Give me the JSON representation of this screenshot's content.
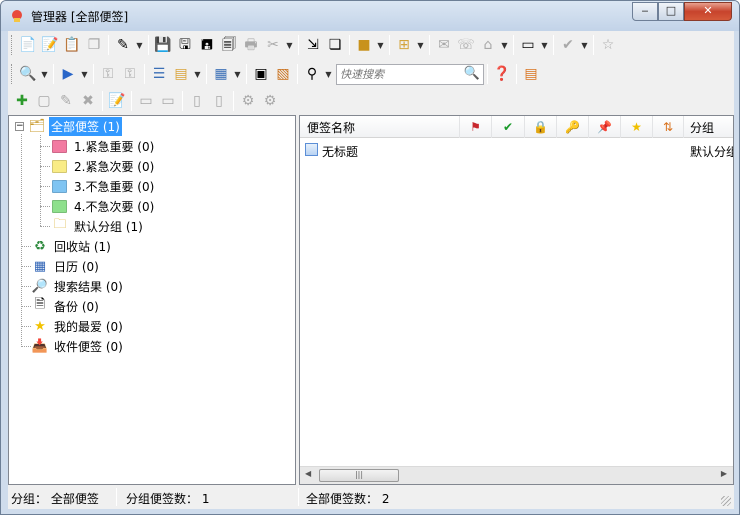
{
  "window": {
    "title": "管理器 [全部便签]",
    "minimize": "‒",
    "maximize": "□",
    "close": "✕"
  },
  "search": {
    "placeholder": "快速搜索"
  },
  "tree": {
    "root": {
      "label": "全部便签 (1)"
    },
    "groups": [
      {
        "label": "1.紧急重要 (0)",
        "color": "#f27aa1"
      },
      {
        "label": "2.紧急次要 (0)",
        "color": "#f9ec86"
      },
      {
        "label": "3.不急重要 (0)",
        "color": "#7fc4f2"
      },
      {
        "label": "4.不急次要 (0)",
        "color": "#8ee08c"
      },
      {
        "label": "默认分组 (1)",
        "color": "#f7d35f"
      }
    ],
    "others": [
      {
        "label": "回收站 (1)",
        "icon": "recycle-bin-icon"
      },
      {
        "label": "日历 (0)",
        "icon": "calendar-icon"
      },
      {
        "label": "搜索结果 (0)",
        "icon": "search-results-icon"
      },
      {
        "label": "备份 (0)",
        "icon": "backup-icon"
      },
      {
        "label": "我的最爱 (0)",
        "icon": "favorite-star-icon"
      },
      {
        "label": "收件便签 (0)",
        "icon": "inbox-icon"
      }
    ]
  },
  "list": {
    "columns": {
      "name": "便签名称",
      "group": "分组"
    },
    "rows": [
      {
        "name": "无标题",
        "group": "默认分组"
      }
    ]
  },
  "status": {
    "group": "分组： 全部便签",
    "group_count": "分组便签数： 1",
    "total_count": "全部便签数： 2"
  }
}
